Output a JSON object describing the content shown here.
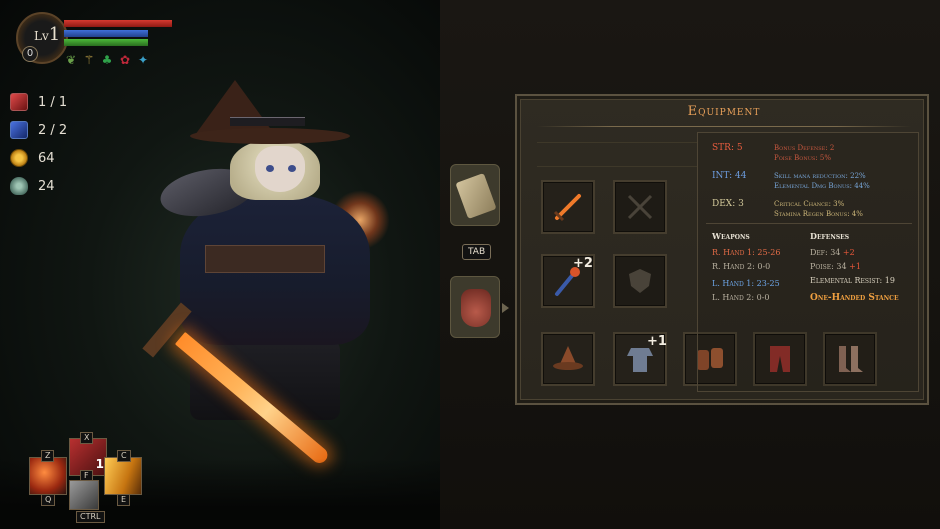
{
  "hud": {
    "level_prefix": "Lv",
    "level_value": "1",
    "souls_badge": "0",
    "bars": {
      "hp_color": "#d63a30",
      "mp_color": "#3f6fd8",
      "stamina_color": "#4cb83a"
    },
    "status_icons": [
      "leaf-icon",
      "wheat-icon",
      "clover-icon",
      "flower-icon",
      "bird-icon"
    ],
    "resources": [
      {
        "icon": "red-potion-icon",
        "value": "1 / 1"
      },
      {
        "icon": "blue-potion-icon",
        "value": "2 / 2"
      },
      {
        "icon": "coin-icon",
        "value": "64"
      },
      {
        "icon": "soul-icon",
        "value": "24"
      }
    ]
  },
  "hotbar": {
    "keys": {
      "z": "Z",
      "q": "Q",
      "x": "X",
      "f": "F",
      "c": "C",
      "e": "E",
      "ctrl": "CTRL"
    },
    "potion_count": "1"
  },
  "tabs": {
    "key_label": "TAB"
  },
  "equipment": {
    "title": "Equipment",
    "weapon_right_bonus": "+2",
    "armor_chest_bonus": "+1",
    "stats": {
      "str": {
        "label": "STR: 5",
        "bonus1": "Bonus Defense: 2",
        "bonus2": "Poise Bonus: 5%"
      },
      "int": {
        "label": "INT: 44",
        "bonus1": "Skill mana reduction: 22%",
        "bonus2": "Elemental Dmg Bonus: 44%"
      },
      "dex": {
        "label": "DEX: 3",
        "bonus1": "Critical Chance: 3%",
        "bonus2": "Stamina Regen Bonus: 4%"
      }
    },
    "weapons": {
      "header": "Weapons",
      "r_hand_1": "R. Hand 1: 25-26",
      "r_hand_2": "R. Hand 2: 0-0",
      "l_hand_1": "L. Hand 1: 23-25",
      "l_hand_2": "L. Hand 2: 0-0"
    },
    "defenses": {
      "header": "Defenses",
      "def_label": "Def: 34",
      "def_bonus": "+2",
      "poise_label": "Poise: 34",
      "poise_bonus": "+1",
      "elemental_resist": "Elemental Resist: 19",
      "stance": "One-Handed Stance"
    }
  }
}
